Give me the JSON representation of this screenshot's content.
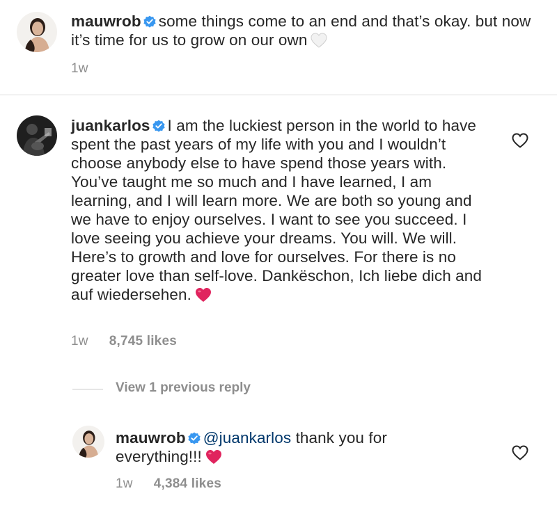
{
  "post_caption": {
    "username": "mauwrob",
    "text": "some things come to an end and that’s okay. but now it’s time for us to grow on our own",
    "emoji": "white-heart",
    "time": "1w"
  },
  "comment": {
    "username": "juankarlos",
    "text": "I am the luckiest person in the world to have spent the past years of my life with you and I wouldn’t choose anybody else to have spend those years with. You’ve taught me so much and I have learned, I am learning, and I will learn more. We are both so young and we have to enjoy ourselves. I want to see you succeed. I love seeing you achieve your dreams. You will. We will. Here’s to growth and love for ourselves. For there is  no greater love than self-love. Dankëschon, Ich liebe dich and auf wiedersehen.",
    "emoji": "red-heart",
    "time": "1w",
    "likes": "8,745 likes"
  },
  "view_replies_label": "View 1 previous reply",
  "reply": {
    "username": "mauwrob",
    "mention": "@juankarlos",
    "text": "thank you for everything!!!",
    "emoji": "red-heart",
    "time": "1w",
    "likes": "4,384 likes"
  },
  "colors": {
    "verified_badge": "#3897f0",
    "mention": "#00376b",
    "meta_text": "#8e8e8e",
    "red_heart": "#e0245e"
  }
}
